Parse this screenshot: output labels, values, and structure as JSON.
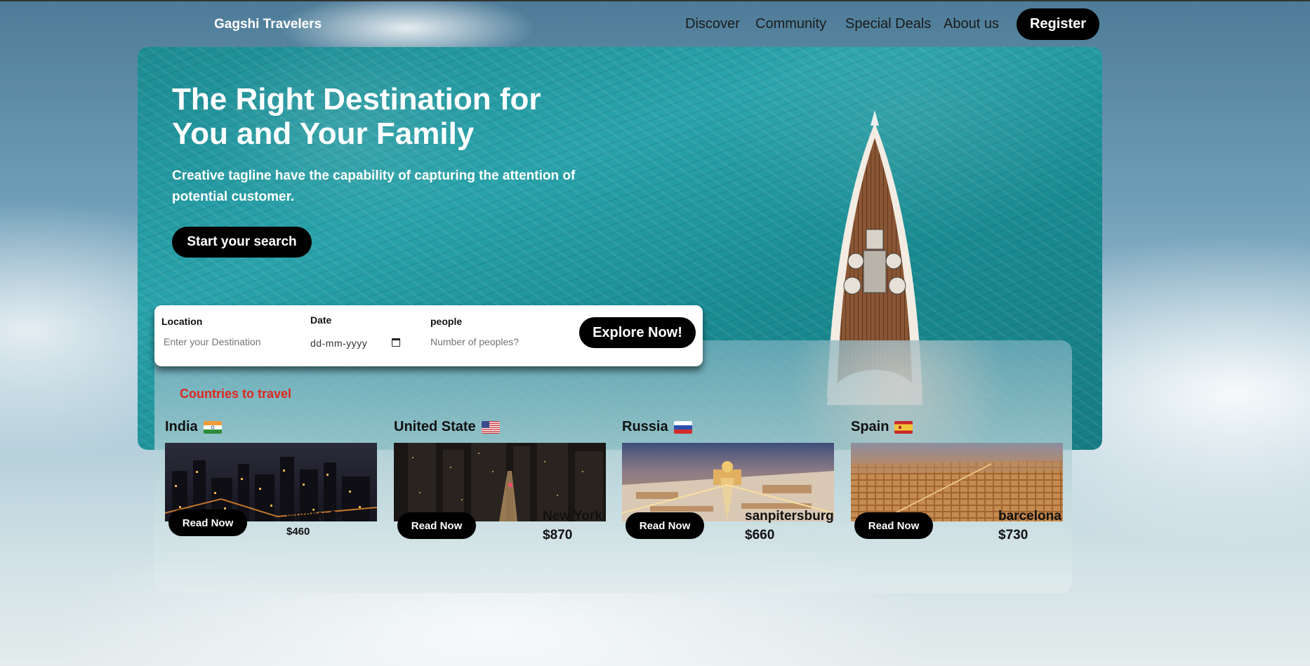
{
  "nav": {
    "brand": "Gagshi Travelers",
    "links": [
      "Discover",
      "Community",
      "Special Deals",
      "About us"
    ],
    "register": "Register"
  },
  "hero": {
    "title_line1": "The Right Destination for",
    "title_line2": "You and Your Family",
    "tagline": "Creative tagline have the capability of capturing the attention of potential customer.",
    "cta": "Start your search"
  },
  "search": {
    "location_label": "Location",
    "location_placeholder": "Enter your Destination",
    "date_label": "Date",
    "date_placeholder": "dd-mm-yyyy",
    "people_label": "people",
    "people_placeholder": "Number of peoples?",
    "explore": "Explore Now!"
  },
  "countries": {
    "title": "Countries to travel",
    "items": [
      {
        "country": "India",
        "flag": "india-flag",
        "city": "Mumbai Central",
        "price": "$460",
        "button": "Read Now"
      },
      {
        "country": "United State",
        "flag": "us-flag",
        "city": "New York",
        "price": "$870",
        "button": "Read Now"
      },
      {
        "country": "Russia",
        "flag": "russia-flag",
        "city": "sanpitersburg",
        "price": "$660",
        "button": "Read Now"
      },
      {
        "country": "Spain",
        "flag": "spain-flag",
        "city": "barcelona",
        "price": "$730",
        "button": "Read Now"
      }
    ]
  },
  "colors": {
    "accent_red": "#e0261d",
    "button_black": "#000000",
    "ocean": "#1e8c93"
  }
}
